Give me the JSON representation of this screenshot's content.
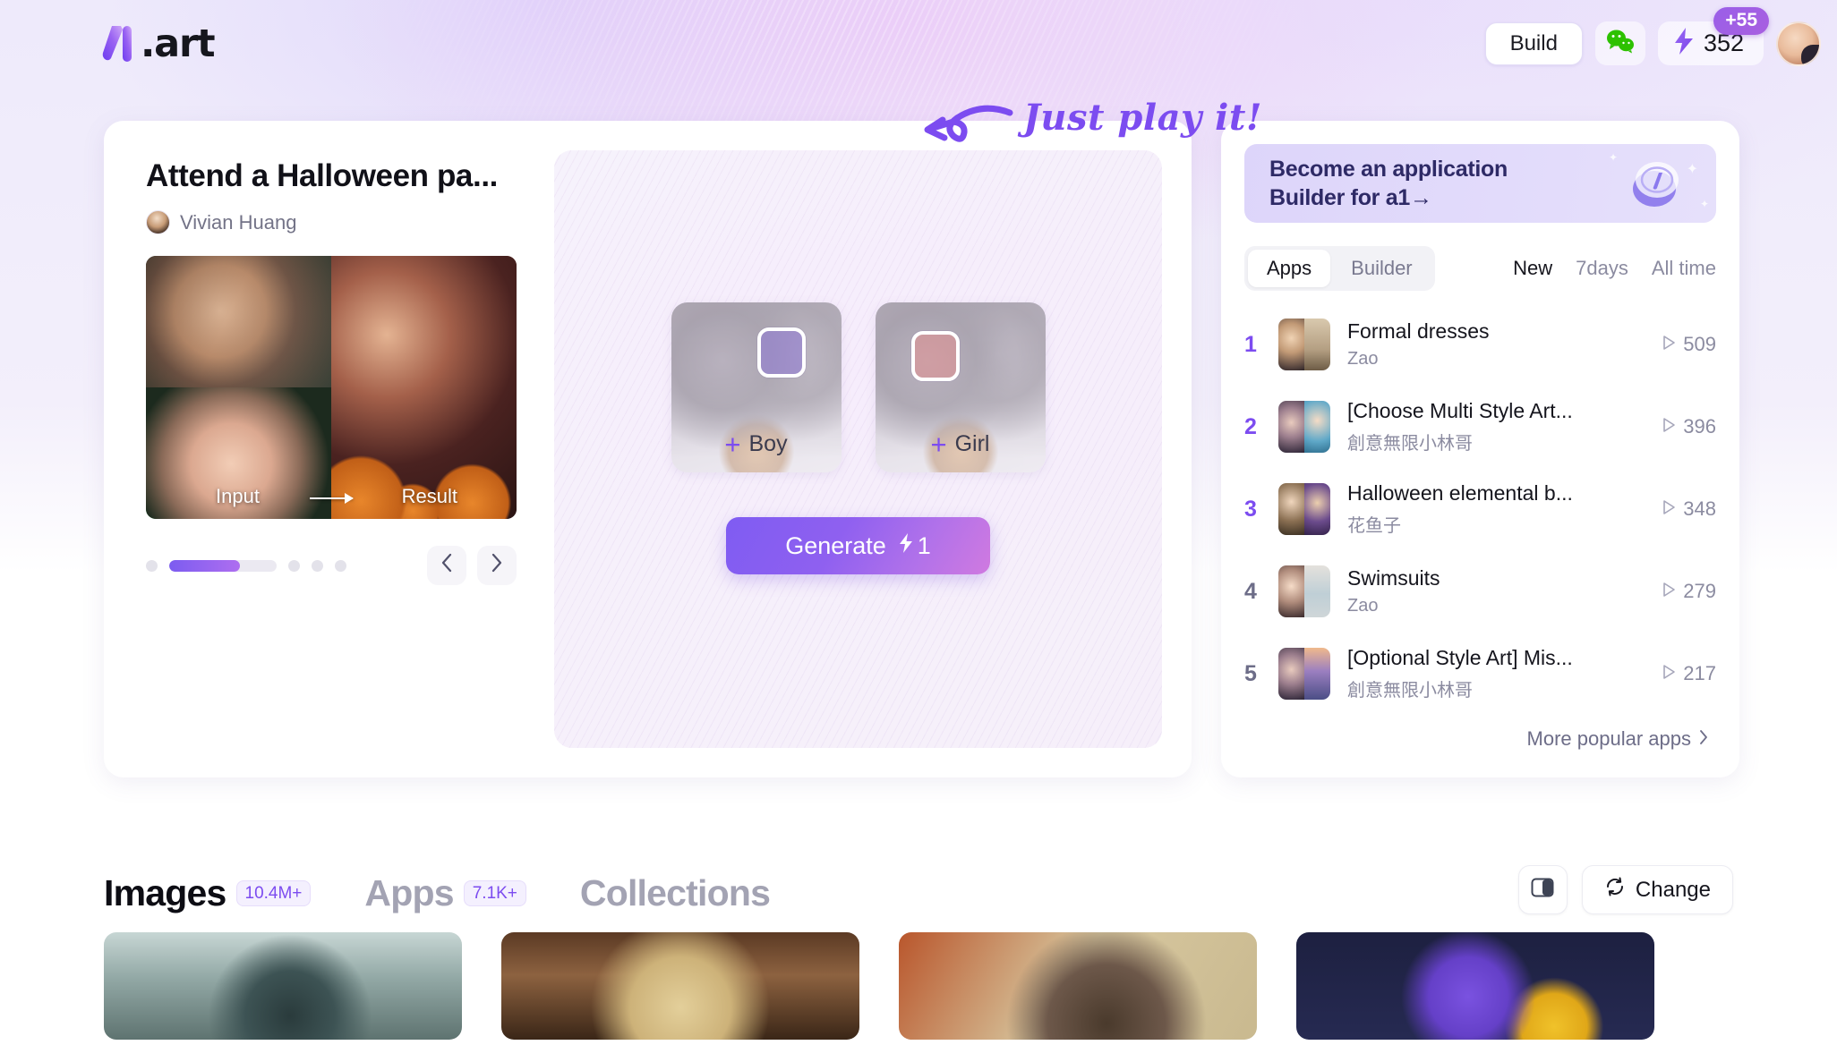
{
  "brand": {
    "name": ".art",
    "logo_icon": "a1-logo-icon"
  },
  "header": {
    "build_label": "Build",
    "wechat_icon": "wechat-icon",
    "bolt_icon": "lightning-bolt-icon",
    "credits": "352",
    "credits_badge": "+55",
    "avatar_icon": "user-avatar"
  },
  "app_card": {
    "title": "Attend a Halloween pa...",
    "author": "Vivian Huang",
    "preview": {
      "input_label": "Input",
      "result_label": "Result",
      "arrow_icon": "arrow-right-icon"
    },
    "carousel": {
      "prev_icon": "chevron-left-icon",
      "next_icon": "chevron-right-icon",
      "dots": 5,
      "active_index": 1,
      "progress_percent": 66
    }
  },
  "generator": {
    "slots": [
      {
        "label": "Boy",
        "plus_icon": "plus-icon",
        "face_frame": "face-frame-icon"
      },
      {
        "label": "Girl",
        "plus_icon": "plus-icon",
        "face_frame": "face-frame-icon"
      }
    ],
    "generate_label": "Generate",
    "generate_cost": "1",
    "bolt_icon": "lightning-bolt-icon"
  },
  "annotation": {
    "text": "Just play it!",
    "arrow_icon": "curved-arrow-left-icon"
  },
  "rank_card": {
    "promo": {
      "line1": "Become an application",
      "line2": "Builder for a1→",
      "coin_icon": "a1-coin-icon"
    },
    "tabs": [
      {
        "label": "Apps",
        "active": true
      },
      {
        "label": "Builder",
        "active": false
      }
    ],
    "filters": [
      {
        "label": "New",
        "active": true
      },
      {
        "label": "7days",
        "active": false
      },
      {
        "label": "All time",
        "active": false
      }
    ],
    "items": [
      {
        "rank": "1",
        "title": "Formal dresses",
        "author": "Zao",
        "plays": "509",
        "play_icon": "play-icon"
      },
      {
        "rank": "2",
        "title": "[Choose Multi Style Art...",
        "author": "創意無限小林哥",
        "plays": "396",
        "play_icon": "play-icon"
      },
      {
        "rank": "3",
        "title": "Halloween elemental b...",
        "author": "花鱼子",
        "plays": "348",
        "play_icon": "play-icon"
      },
      {
        "rank": "4",
        "title": "Swimsuits",
        "author": "Zao",
        "plays": "279",
        "play_icon": "play-icon"
      },
      {
        "rank": "5",
        "title": "[Optional Style Art] Mis...",
        "author": "創意無限小林哥",
        "plays": "217",
        "play_icon": "play-icon"
      }
    ],
    "more_label": "More popular apps",
    "more_icon": "chevron-right-icon"
  },
  "bottom": {
    "tabs": [
      {
        "label": "Images",
        "badge": "10.4M+",
        "active": true
      },
      {
        "label": "Apps",
        "badge": "7.1K+",
        "active": false
      },
      {
        "label": "Collections",
        "badge": "",
        "active": false
      }
    ],
    "layout_icon": "panel-layout-icon",
    "change_label": "Change",
    "change_icon": "refresh-icon"
  },
  "colors": {
    "accent": "#7c4cf0",
    "accent_gradient_start": "#7f5cf2",
    "accent_gradient_end": "#d07ae0",
    "wechat_green": "#2dc100",
    "text_primary": "#15151d",
    "text_muted": "#8b8ba0"
  }
}
